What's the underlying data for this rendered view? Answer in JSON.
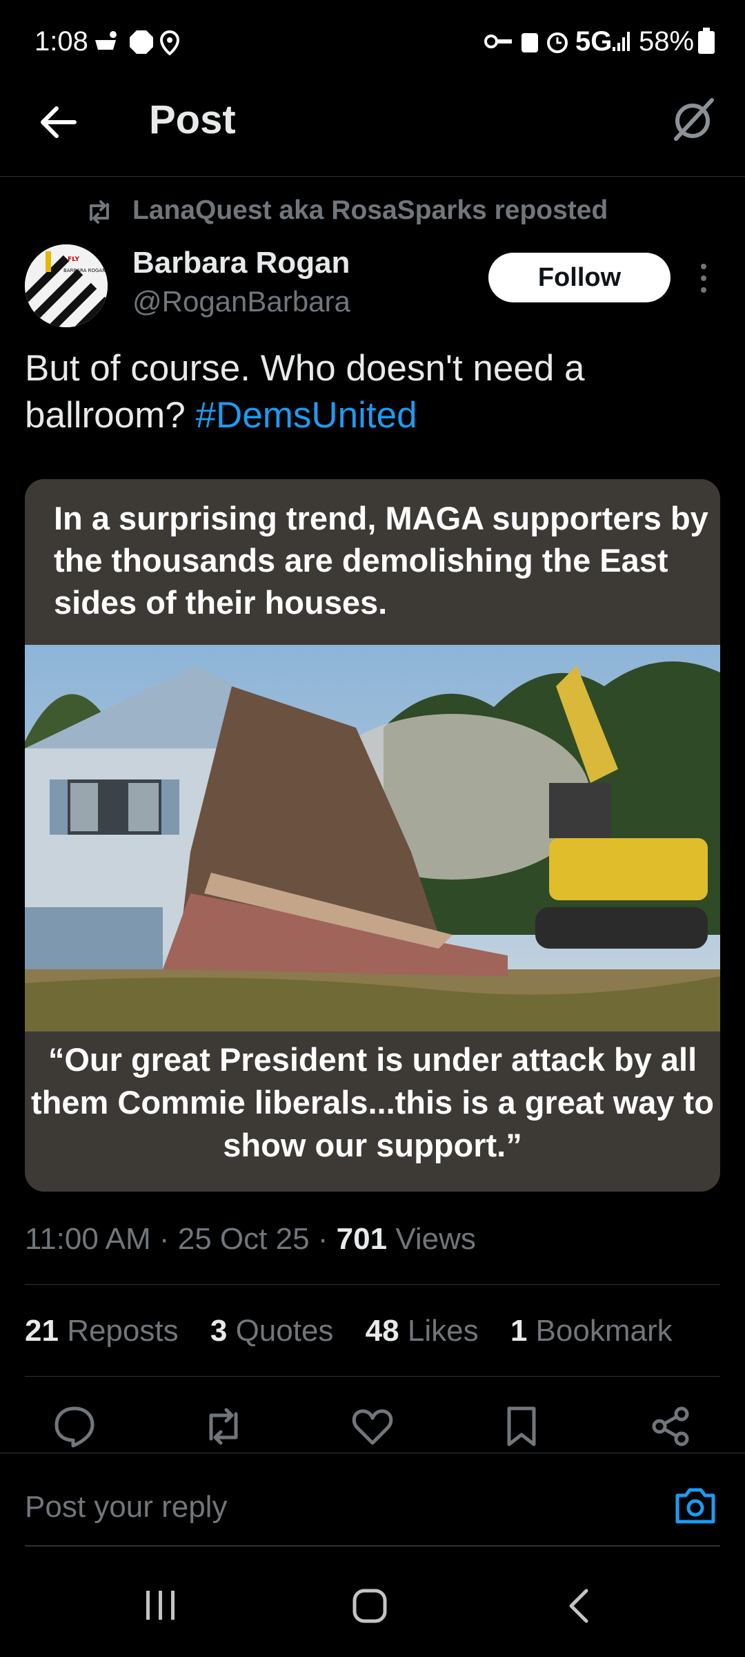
{
  "status_bar": {
    "time": "1:08",
    "network": "5G",
    "battery": "58%"
  },
  "header": {
    "title": "Post",
    "back_icon": "arrow-left-icon",
    "grok_icon": "grok-icon"
  },
  "repost": {
    "text": "LanaQuest aka RosaSparks reposted"
  },
  "author": {
    "name": "Barbara Rogan",
    "handle": "@RoganBarbara",
    "follow_label": "Follow",
    "avatar_text": "BARBARA ROGAN"
  },
  "post": {
    "text": "But of course. Who doesn't need a ballroom? ",
    "hashtag": "#DemsUnited"
  },
  "media": {
    "headline": "In a surprising trend, MAGA supporters by the thousands are demolishing the East sides of their houses.",
    "quote": "“Our great President is under attack by all them Commie liberals...this is a great way to show our support.”"
  },
  "meta": {
    "time": "11:00 AM",
    "date": "25 Oct 25",
    "views_count": "701",
    "views_label": "Views"
  },
  "stats": [
    {
      "count": "21",
      "label": "Reposts"
    },
    {
      "count": "3",
      "label": "Quotes"
    },
    {
      "count": "48",
      "label": "Likes"
    },
    {
      "count": "1",
      "label": "Bookmark"
    }
  ],
  "actions": [
    "reply-icon",
    "repost-icon",
    "like-icon",
    "bookmark-icon",
    "share-icon"
  ],
  "reply": {
    "placeholder": "Post your reply"
  },
  "colors": {
    "background": "#000000",
    "text": "#e7e9ea",
    "muted": "#71767b",
    "accent": "#1d9bf0",
    "card": "#3d3935"
  }
}
